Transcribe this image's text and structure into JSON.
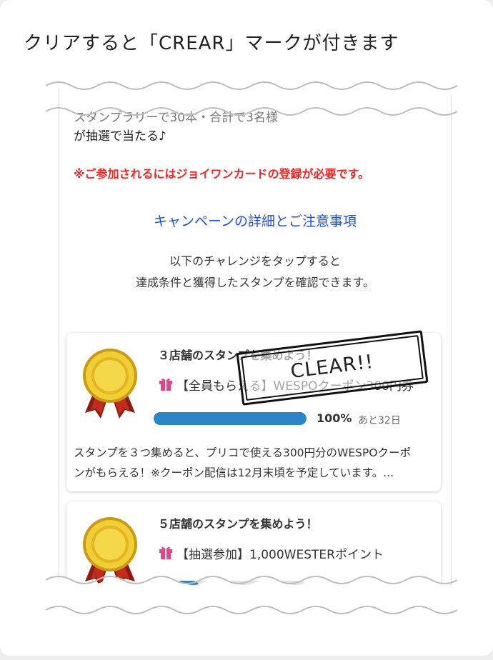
{
  "headline": "クリアすると「CREAR」マークが付きます",
  "intro": {
    "line1_cut": "スタンプラリーで30本・合計で3名様",
    "line2": "が抽選で当たる♪",
    "warning": "※ご参加されるにはジョイワンカードの登録が必要です。",
    "campaign_link": "キャンペーンの詳細とご注意事項",
    "instruction_1": "以下のチャレンジをタップすると",
    "instruction_2": "達成条件と獲得したスタンプを確認できます。"
  },
  "challenges": [
    {
      "title": "３店舗のスタンプを集めよう！",
      "reward": "【全員もらえる】WESPOクーポン300円券",
      "progress": 1.0,
      "progress_label": "100%",
      "days_left": "あと32日",
      "description_1": "スタンプを３つ集めると、プリコで使える300円分のWESPOクーポ",
      "description_2": "ンがもらえる！※クーポン配信は12月末頃を予定しています。...",
      "stamp": "CLEAR!!"
    },
    {
      "title": "５店舗のスタンプを集めよう！",
      "reward": "【抽選参加】1,000WESTERポイント"
    }
  ],
  "icons": {
    "medal": "gold-medal-icon",
    "gift": "gift-icon"
  },
  "colors": {
    "warning": "#ff1f1f",
    "link": "#1e4ee6",
    "progress": "#2b86c9",
    "gift": "#e8418a",
    "medal": "#e5c027"
  }
}
